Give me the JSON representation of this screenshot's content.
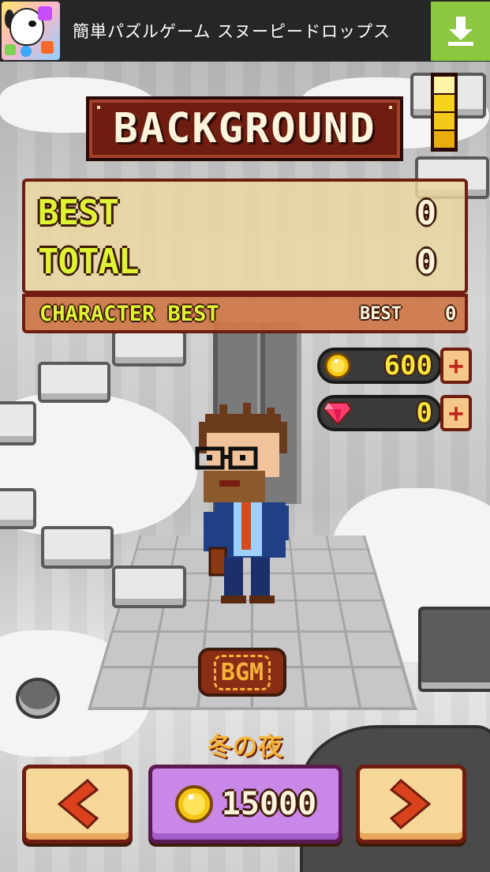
{
  "ad": {
    "title": "簡単パズルゲーム スヌーピードロップス"
  },
  "header": {
    "title": "BACKGROUND"
  },
  "level_meter": {
    "fill_fraction": 0.75,
    "segments": 4
  },
  "stats": {
    "best_label": "BEST",
    "best_value": "0",
    "total_label": "TOTAL",
    "total_value": "0",
    "character_best_label": "CHARACTER BEST",
    "character_best_sub_label": "BEST",
    "character_best_value": "0"
  },
  "currency": {
    "coins": "600",
    "coins_icon": "gold-coin-icon",
    "gems": "0",
    "gems_icon": "ruby-gem-icon",
    "plus_label": "+"
  },
  "bgm": {
    "label": "BGM"
  },
  "background": {
    "name": "冬の夜"
  },
  "purchase": {
    "price": "15000",
    "icon": "gold-coin-icon"
  },
  "colors": {
    "title_bg": "#6e1d10",
    "stat_label": "#dff534",
    "coin_text": "#f8e43a",
    "buy_button": "#c987e8",
    "arrow_button": "#f7d69a",
    "arrow_color": "#d9421c",
    "ad_download": "#8dc63f"
  }
}
